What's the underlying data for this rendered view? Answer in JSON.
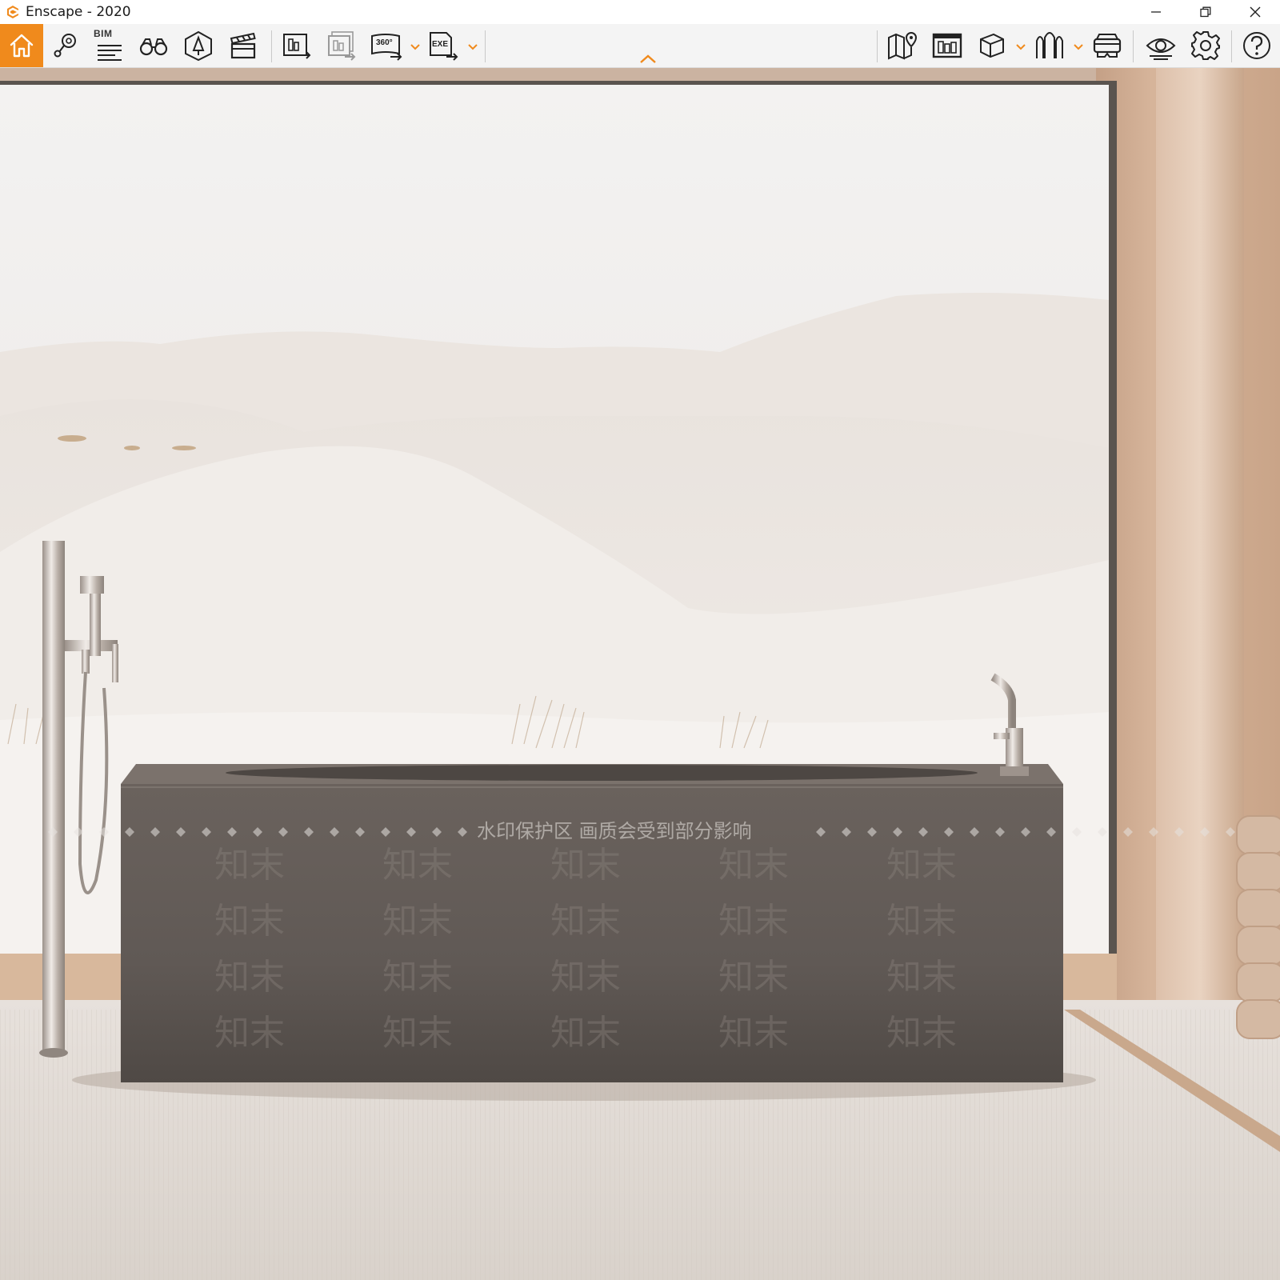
{
  "window": {
    "title": "Enscape - 2020"
  },
  "toolbar": {
    "left_tools": [
      "home-icon",
      "location-pin-icon",
      "bim-list-icon",
      "binoculars-icon",
      "orientation-icon",
      "clapboard-icon"
    ],
    "bim_label": "BIM",
    "export_tools": [
      "screenshot-export-icon",
      "batch-export-icon",
      "panorama-360-icon",
      "exe-export-icon"
    ],
    "panorama_label": "360°",
    "exe_label": "EXE",
    "right_tools": [
      "map-pin-icon",
      "asset-library-icon",
      "cube-icon",
      "arch-icon",
      "vr-headset-icon",
      "eye-icon",
      "gear-icon",
      "help-icon"
    ],
    "accent_color": "#f08a1c"
  },
  "viewport": {
    "scene": "bathroom-render",
    "watermark_banner": "水印保护区   画质会受到部分影响",
    "watermark_tile": "知末"
  }
}
